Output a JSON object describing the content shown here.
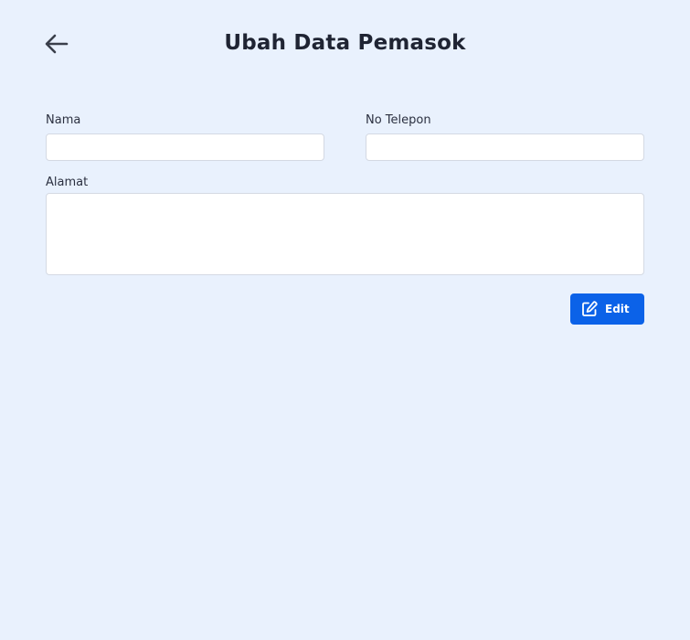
{
  "header": {
    "back_icon": "arrow-left-icon",
    "title": "Ubah Data Pemasok"
  },
  "form": {
    "nama": {
      "label": "Nama",
      "value": "",
      "placeholder": ""
    },
    "telepon": {
      "label": "No Telepon",
      "value": "",
      "placeholder": ""
    },
    "alamat": {
      "label": "Alamat",
      "value": "",
      "placeholder": ""
    },
    "submit": {
      "label": "Edit",
      "icon": "edit-icon"
    }
  },
  "colors": {
    "background": "#e9f1fd",
    "accent": "#0b62e8",
    "text": "#1f2433"
  }
}
